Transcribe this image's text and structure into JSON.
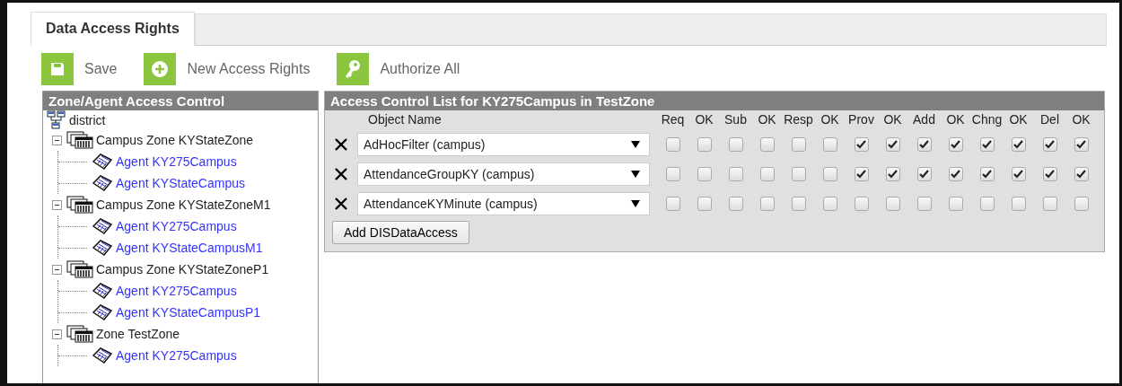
{
  "tab": {
    "label": "Data Access Rights",
    "selected": true
  },
  "toolbar": [
    {
      "label": "Save",
      "kind": "save"
    },
    {
      "label": "New Access Rights",
      "kind": "new"
    },
    {
      "label": "Authorize All",
      "kind": "authorize"
    }
  ],
  "tree": {
    "title": "Zone/Agent Access Control",
    "root": {
      "label": "district",
      "children": [
        {
          "label": "Campus Zone KYStateZone",
          "expanded": true,
          "children": [
            {
              "label": "Agent KY275Campus"
            },
            {
              "label": "Agent KYStateCampus"
            }
          ]
        },
        {
          "label": "Campus Zone KYStateZoneM1",
          "expanded": true,
          "children": [
            {
              "label": "Agent KY275Campus"
            },
            {
              "label": "Agent KYStateCampusM1"
            }
          ]
        },
        {
          "label": "Campus Zone KYStateZoneP1",
          "expanded": true,
          "children": [
            {
              "label": "Agent KY275Campus"
            },
            {
              "label": "Agent KYStateCampusP1"
            }
          ]
        },
        {
          "label": "Zone TestZone",
          "expanded": true,
          "children": [
            {
              "label": "Agent KY275Campus"
            }
          ]
        }
      ]
    }
  },
  "acl": {
    "title": "Access Control List for KY275Campus in TestZone",
    "object_header": "Object Name",
    "columns": [
      "Req",
      "OK",
      "Sub",
      "OK",
      "Resp",
      "OK",
      "Prov",
      "OK",
      "Add",
      "OK",
      "Chng",
      "OK",
      "Del",
      "OK"
    ],
    "rows": [
      {
        "object": "AdHocFilter (campus)",
        "checks": [
          false,
          false,
          false,
          false,
          false,
          false,
          true,
          true,
          true,
          true,
          true,
          true,
          true,
          true
        ]
      },
      {
        "object": "AttendanceGroupKY (campus)",
        "checks": [
          false,
          false,
          false,
          false,
          false,
          false,
          true,
          true,
          true,
          true,
          true,
          true,
          true,
          true
        ]
      },
      {
        "object": "AttendanceKYMinute (campus)",
        "checks": [
          false,
          false,
          false,
          false,
          false,
          false,
          false,
          false,
          false,
          false,
          false,
          false,
          false,
          false
        ]
      }
    ],
    "add_button": "Add DISDataAccess"
  }
}
